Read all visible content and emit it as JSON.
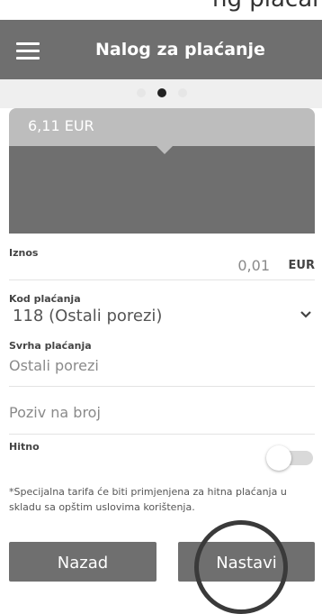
{
  "top_strip_text": "ng plaćanja",
  "header": {
    "title": "Nalog za plaćanje",
    "menu_icon": "hamburger-menu-icon"
  },
  "pager": {
    "active_index": 1,
    "count": 3
  },
  "card": {
    "amount": "6,11 EUR"
  },
  "form": {
    "amount": {
      "label": "Iznos",
      "value": "0,01",
      "currency": "EUR"
    },
    "payment_code": {
      "label": "Kod plaćanja",
      "value": "118 (Ostali porezi)"
    },
    "purpose": {
      "label": "Svrha plaćanja",
      "value": "Ostali porezi"
    },
    "reference": {
      "placeholder": "Poziv na broj"
    },
    "urgent": {
      "label": "Hitno",
      "enabled": false
    },
    "note": "*Specijalna tarifa će biti primjenjena za hitna plaćanja u skladu sa opštim uslovima korištenja."
  },
  "buttons": {
    "back": "Nazad",
    "next": "Nastavi"
  },
  "colors": {
    "primary": "#6f6f6f",
    "card_top": "#bdbdbd",
    "pager_bg": "#efefef"
  }
}
